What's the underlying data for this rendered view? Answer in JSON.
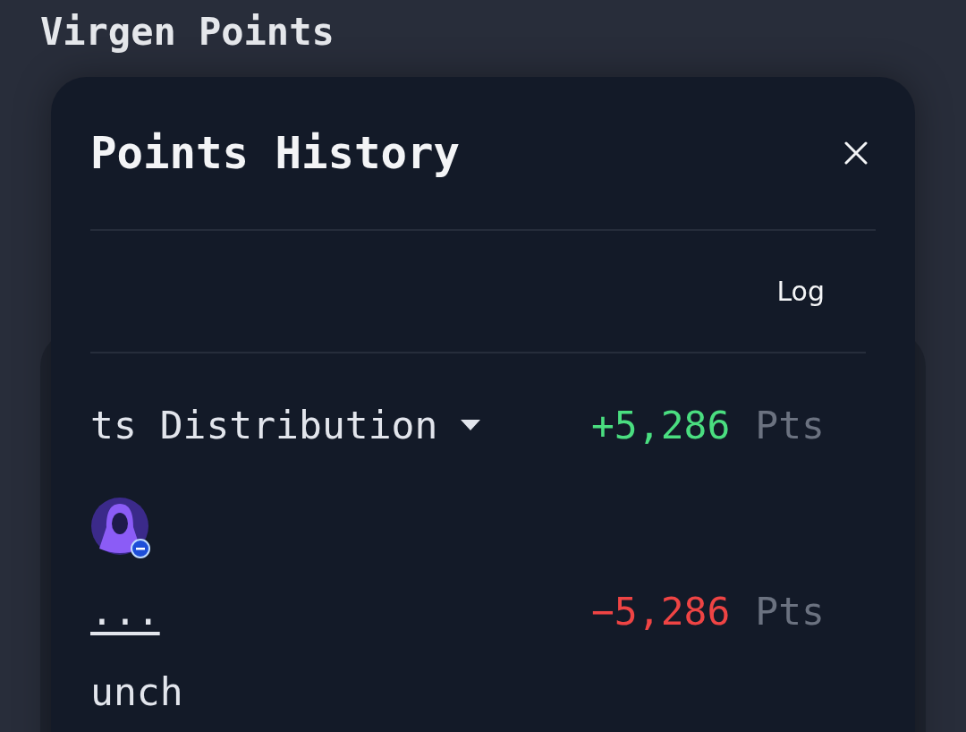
{
  "page": {
    "title": "Virgen Points"
  },
  "modal": {
    "title": "Points History",
    "tab_label": "Log",
    "entries": [
      {
        "kind": "credit",
        "avatar": false,
        "label": "ts Distribution",
        "expandable": true,
        "amount": "+5,286",
        "unit": "Pts"
      },
      {
        "kind": "debit",
        "avatar": true,
        "expandable": false,
        "link": "...",
        "amount": "−5,286",
        "unit": "Pts",
        "note": "unch"
      }
    ]
  }
}
